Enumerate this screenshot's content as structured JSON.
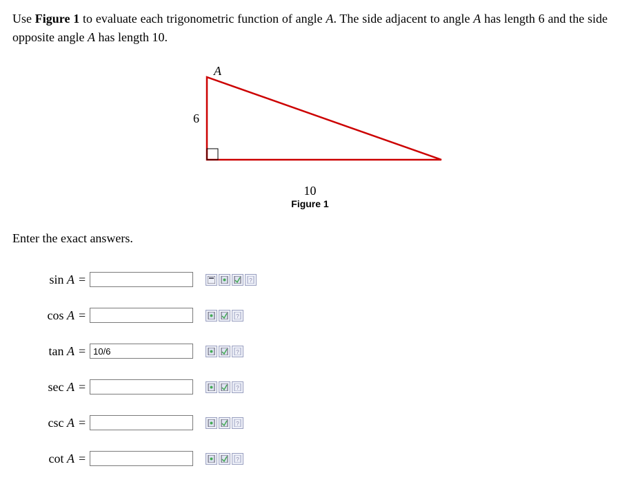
{
  "instructions": {
    "part1": "Use ",
    "fig_ref": "Figure 1",
    "part2": " to evaluate each trigonometric function of angle ",
    "angle": "A",
    "part3": ". The side adjacent to angle ",
    "part4": " has length 6 and the side opposite angle ",
    "part5": " has length 10."
  },
  "figure": {
    "label_A": "A",
    "label_adjacent": "6",
    "label_opposite": "10",
    "caption": "Figure 1"
  },
  "prompt": "Enter the exact answers.",
  "rows": [
    {
      "func": "sin",
      "var": "A",
      "value": "",
      "extra_icon": true
    },
    {
      "func": "cos",
      "var": "A",
      "value": "",
      "extra_icon": false
    },
    {
      "func": "tan",
      "var": "A",
      "value": "10/6",
      "extra_icon": false
    },
    {
      "func": "sec",
      "var": "A",
      "value": "",
      "extra_icon": false
    },
    {
      "func": "csc",
      "var": "A",
      "value": "",
      "extra_icon": false
    },
    {
      "func": "cot",
      "var": "A",
      "value": "",
      "extra_icon": false
    }
  ],
  "equals": "="
}
